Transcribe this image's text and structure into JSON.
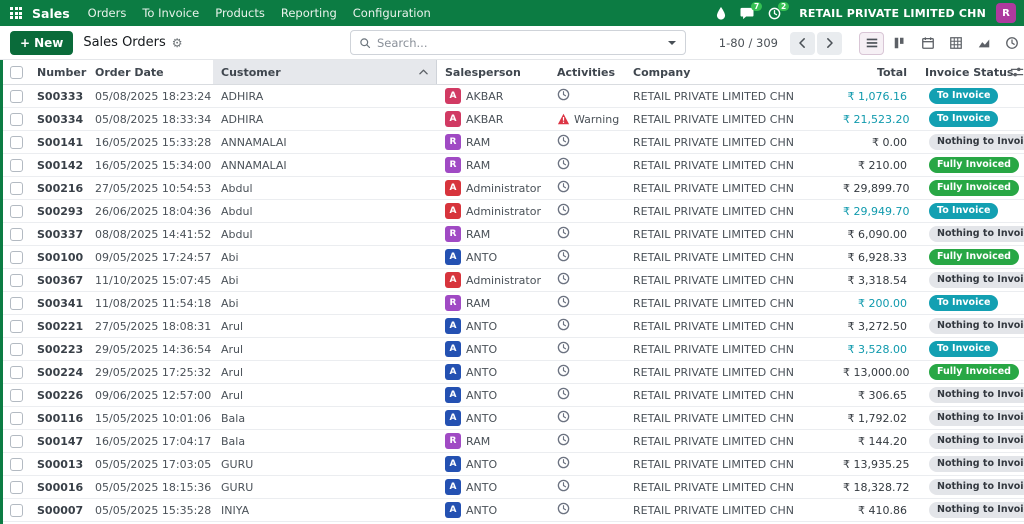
{
  "navbar": {
    "app_name": "Sales",
    "menus": [
      "Orders",
      "To Invoice",
      "Products",
      "Reporting",
      "Configuration"
    ],
    "messages_badge": "7",
    "activities_badge": "2",
    "company": "RETAIL PRIVATE LIMITED CHN",
    "avatar_initial": "R"
  },
  "control_panel": {
    "new_label": "New",
    "title": "Sales Orders",
    "search_placeholder": "Search...",
    "pager_text": "1-80 / 309"
  },
  "colors": {
    "navbar_green": "#0c7c43",
    "accent_info": "#13a0b2",
    "success_green": "#28a745",
    "warning_red": "#dc3545",
    "avatar_akbar": "#d13a63",
    "avatar_ram": "#a04ac4",
    "avatar_admin": "#d7343c",
    "avatar_anto": "#2451b2",
    "navbar_avatar": "#ad3a9e"
  },
  "table": {
    "headers": {
      "number": "Number",
      "order_date": "Order Date",
      "customer": "Customer",
      "salesperson": "Salesperson",
      "activities": "Activities",
      "company": "Company",
      "total": "Total",
      "invoice_status": "Invoice Status"
    },
    "rows": [
      {
        "number": "S00333",
        "date": "05/08/2025 18:23:24",
        "customer": "ADHIRA",
        "sp_initial": "A",
        "sp_name": "AKBAR",
        "sp_color": "#d13a63",
        "activity": "clock",
        "activity_label": "",
        "company": "RETAIL PRIVATE LIMITED CHN",
        "total": "₹ 1,076.16",
        "total_variant": "info",
        "status": "To Invoice",
        "status_variant": "info"
      },
      {
        "number": "S00334",
        "date": "05/08/2025 18:33:34",
        "customer": "ADHIRA",
        "sp_initial": "A",
        "sp_name": "AKBAR",
        "sp_color": "#d13a63",
        "activity": "warning",
        "activity_label": "Warning",
        "company": "RETAIL PRIVATE LIMITED CHN",
        "total": "₹ 21,523.20",
        "total_variant": "info",
        "status": "To Invoice",
        "status_variant": "info"
      },
      {
        "number": "S00141",
        "date": "16/05/2025 15:33:28",
        "customer": "ANNAMALAI",
        "sp_initial": "R",
        "sp_name": "RAM",
        "sp_color": "#a04ac4",
        "activity": "clock",
        "activity_label": "",
        "company": "RETAIL PRIVATE LIMITED CHN",
        "total": "₹ 0.00",
        "total_variant": "normal",
        "status": "Nothing to Invoice",
        "status_variant": "muted"
      },
      {
        "number": "S00142",
        "date": "16/05/2025 15:34:00",
        "customer": "ANNAMALAI",
        "sp_initial": "R",
        "sp_name": "RAM",
        "sp_color": "#a04ac4",
        "activity": "clock",
        "activity_label": "",
        "company": "RETAIL PRIVATE LIMITED CHN",
        "total": "₹ 210.00",
        "total_variant": "normal",
        "status": "Fully Invoiced",
        "status_variant": "success"
      },
      {
        "number": "S00216",
        "date": "27/05/2025 10:54:53",
        "customer": "Abdul",
        "sp_initial": "A",
        "sp_name": "Administrator",
        "sp_color": "#d7343c",
        "activity": "clock",
        "activity_label": "",
        "company": "RETAIL PRIVATE LIMITED CHN",
        "total": "₹ 29,899.70",
        "total_variant": "normal",
        "status": "Fully Invoiced",
        "status_variant": "success"
      },
      {
        "number": "S00293",
        "date": "26/06/2025 18:04:36",
        "customer": "Abdul",
        "sp_initial": "A",
        "sp_name": "Administrator",
        "sp_color": "#d7343c",
        "activity": "clock",
        "activity_label": "",
        "company": "RETAIL PRIVATE LIMITED CHN",
        "total": "₹ 29,949.70",
        "total_variant": "info",
        "status": "To Invoice",
        "status_variant": "info"
      },
      {
        "number": "S00337",
        "date": "08/08/2025 14:41:52",
        "customer": "Abdul",
        "sp_initial": "R",
        "sp_name": "RAM",
        "sp_color": "#a04ac4",
        "activity": "clock",
        "activity_label": "",
        "company": "RETAIL PRIVATE LIMITED CHN",
        "total": "₹ 6,090.00",
        "total_variant": "normal",
        "status": "Nothing to Invoice",
        "status_variant": "muted"
      },
      {
        "number": "S00100",
        "date": "09/05/2025 17:24:57",
        "customer": "Abi",
        "sp_initial": "A",
        "sp_name": "ANTO",
        "sp_color": "#2451b2",
        "activity": "clock",
        "activity_label": "",
        "company": "RETAIL PRIVATE LIMITED CHN",
        "total": "₹ 6,928.33",
        "total_variant": "normal",
        "status": "Fully Invoiced",
        "status_variant": "success"
      },
      {
        "number": "S00367",
        "date": "11/10/2025 15:07:45",
        "customer": "Abi",
        "sp_initial": "A",
        "sp_name": "Administrator",
        "sp_color": "#d7343c",
        "activity": "clock",
        "activity_label": "",
        "company": "RETAIL PRIVATE LIMITED CHN",
        "total": "₹ 3,318.54",
        "total_variant": "normal",
        "status": "Nothing to Invoice",
        "status_variant": "muted"
      },
      {
        "number": "S00341",
        "date": "11/08/2025 11:54:18",
        "customer": "Abi",
        "sp_initial": "R",
        "sp_name": "RAM",
        "sp_color": "#a04ac4",
        "activity": "clock",
        "activity_label": "",
        "company": "RETAIL PRIVATE LIMITED CHN",
        "total": "₹ 200.00",
        "total_variant": "info",
        "status": "To Invoice",
        "status_variant": "info"
      },
      {
        "number": "S00221",
        "date": "27/05/2025 18:08:31",
        "customer": "Arul",
        "sp_initial": "A",
        "sp_name": "ANTO",
        "sp_color": "#2451b2",
        "activity": "clock",
        "activity_label": "",
        "company": "RETAIL PRIVATE LIMITED CHN",
        "total": "₹ 3,272.50",
        "total_variant": "normal",
        "status": "Nothing to Invoice",
        "status_variant": "muted"
      },
      {
        "number": "S00223",
        "date": "29/05/2025 14:36:54",
        "customer": "Arul",
        "sp_initial": "A",
        "sp_name": "ANTO",
        "sp_color": "#2451b2",
        "activity": "clock",
        "activity_label": "",
        "company": "RETAIL PRIVATE LIMITED CHN",
        "total": "₹ 3,528.00",
        "total_variant": "info",
        "status": "To Invoice",
        "status_variant": "info"
      },
      {
        "number": "S00224",
        "date": "29/05/2025 17:25:32",
        "customer": "Arul",
        "sp_initial": "A",
        "sp_name": "ANTO",
        "sp_color": "#2451b2",
        "activity": "clock",
        "activity_label": "",
        "company": "RETAIL PRIVATE LIMITED CHN",
        "total": "₹ 13,000.00",
        "total_variant": "normal",
        "status": "Fully Invoiced",
        "status_variant": "success"
      },
      {
        "number": "S00226",
        "date": "09/06/2025 12:57:00",
        "customer": "Arul",
        "sp_initial": "A",
        "sp_name": "ANTO",
        "sp_color": "#2451b2",
        "activity": "clock",
        "activity_label": "",
        "company": "RETAIL PRIVATE LIMITED CHN",
        "total": "₹ 306.65",
        "total_variant": "normal",
        "status": "Nothing to Invoice",
        "status_variant": "muted"
      },
      {
        "number": "S00116",
        "date": "15/05/2025 10:01:06",
        "customer": "Bala",
        "sp_initial": "A",
        "sp_name": "ANTO",
        "sp_color": "#2451b2",
        "activity": "clock",
        "activity_label": "",
        "company": "RETAIL PRIVATE LIMITED CHN",
        "total": "₹ 1,792.02",
        "total_variant": "normal",
        "status": "Nothing to Invoice",
        "status_variant": "muted"
      },
      {
        "number": "S00147",
        "date": "16/05/2025 17:04:17",
        "customer": "Bala",
        "sp_initial": "R",
        "sp_name": "RAM",
        "sp_color": "#a04ac4",
        "activity": "clock",
        "activity_label": "",
        "company": "RETAIL PRIVATE LIMITED CHN",
        "total": "₹ 144.20",
        "total_variant": "normal",
        "status": "Nothing to Invoice",
        "status_variant": "muted"
      },
      {
        "number": "S00013",
        "date": "05/05/2025 17:03:05",
        "customer": "GURU",
        "sp_initial": "A",
        "sp_name": "ANTO",
        "sp_color": "#2451b2",
        "activity": "clock",
        "activity_label": "",
        "company": "RETAIL PRIVATE LIMITED CHN",
        "total": "₹ 13,935.25",
        "total_variant": "normal",
        "status": "Nothing to Invoice",
        "status_variant": "muted"
      },
      {
        "number": "S00016",
        "date": "05/05/2025 18:15:36",
        "customer": "GURU",
        "sp_initial": "A",
        "sp_name": "ANTO",
        "sp_color": "#2451b2",
        "activity": "clock",
        "activity_label": "",
        "company": "RETAIL PRIVATE LIMITED CHN",
        "total": "₹ 18,328.72",
        "total_variant": "normal",
        "status": "Nothing to Invoice",
        "status_variant": "muted"
      },
      {
        "number": "S00007",
        "date": "05/05/2025 15:35:28",
        "customer": "INIYA",
        "sp_initial": "A",
        "sp_name": "ANTO",
        "sp_color": "#2451b2",
        "activity": "clock",
        "activity_label": "",
        "company": "RETAIL PRIVATE LIMITED CHN",
        "total": "₹ 410.86",
        "total_variant": "normal",
        "status": "Nothing to Invoice",
        "status_variant": "muted"
      }
    ]
  }
}
